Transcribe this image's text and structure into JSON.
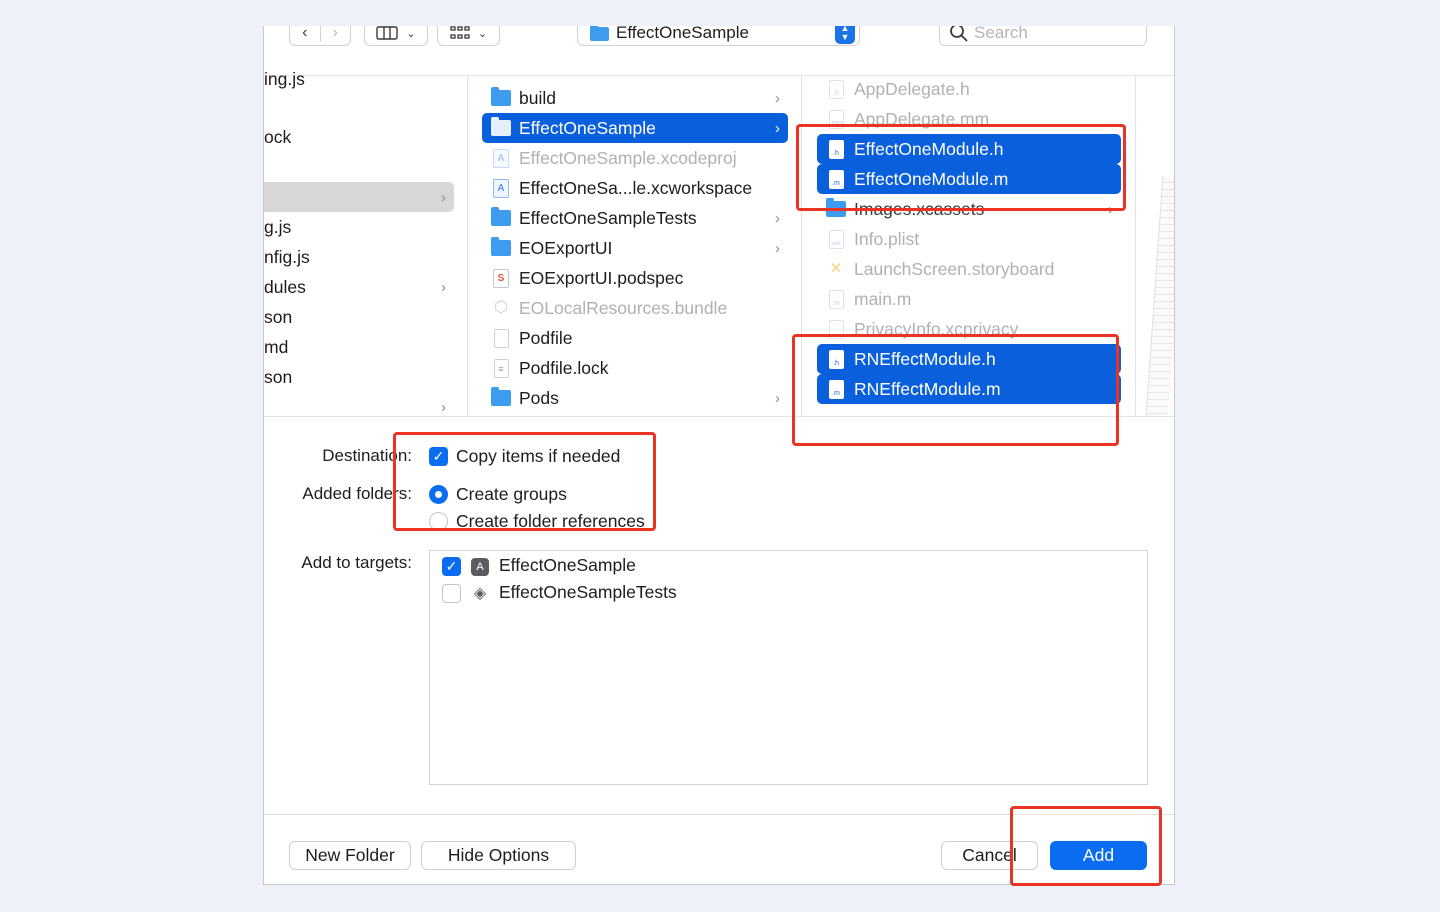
{
  "toolbar": {
    "back": "‹",
    "forward": "›",
    "path_title": "EffectOneSample",
    "search_placeholder": "Search"
  },
  "left_column": [
    {
      "label": "ing.js"
    },
    {
      "label": "ock"
    },
    {
      "label": "",
      "selected": true,
      "arrow": true
    },
    {
      "label": "g.js"
    },
    {
      "label": "nfig.js"
    },
    {
      "label": "dules",
      "arrow": true
    },
    {
      "label": "son"
    },
    {
      "label": "md"
    },
    {
      "label": "son"
    },
    {
      "label": "",
      "arrow": true
    }
  ],
  "middle_column": [
    {
      "label": "build",
      "icon": "folder-icon",
      "arrow": true
    },
    {
      "label": "EffectOneSample",
      "icon": "folder-icon",
      "arrow": true,
      "selected": true
    },
    {
      "label": "EffectOneSample.xcodeproj",
      "icon": "xcodeproj-icon",
      "faded": true
    },
    {
      "label": "EffectOneSa...le.xcworkspace",
      "icon": "xcworkspace-icon"
    },
    {
      "label": "EffectOneSampleTests",
      "icon": "folder-icon",
      "arrow": true
    },
    {
      "label": "EOExportUI",
      "icon": "folder-icon",
      "arrow": true
    },
    {
      "label": "EOExportUI.podspec",
      "icon": "swift-file-icon"
    },
    {
      "label": "EOLocalResources.bundle",
      "icon": "bundle-icon",
      "faded": true
    },
    {
      "label": "Podfile",
      "icon": "file-icon"
    },
    {
      "label": "Podfile.lock",
      "icon": "text-file-icon"
    },
    {
      "label": "Pods",
      "icon": "folder-icon",
      "arrow": true
    }
  ],
  "right_column": [
    {
      "label": "AppDelegate.h",
      "ext": ".h",
      "faded": true
    },
    {
      "label": "AppDelegate.mm",
      "ext": ".mm",
      "faded": true
    },
    {
      "label": "EffectOneModule.h",
      "ext": ".h",
      "selected": true
    },
    {
      "label": "EffectOneModule.m",
      "ext": ".m",
      "selected": true
    },
    {
      "label": "Images.xcassets",
      "icon": "folder-icon",
      "faded": true,
      "arrow": true
    },
    {
      "label": "Info.plist",
      "ext": "plist",
      "faded": true
    },
    {
      "label": "LaunchScreen.storyboard",
      "icon": "storyboard-icon",
      "faded": true
    },
    {
      "label": "main.m",
      "ext": ".m",
      "faded": true
    },
    {
      "label": "PrivacyInfo.xcprivacy",
      "ext": "",
      "faded": true
    },
    {
      "label": "RNEffectModule.h",
      "ext": ".h",
      "selected": true
    },
    {
      "label": "RNEffectModule.m",
      "ext": ".m",
      "selected": true
    }
  ],
  "options": {
    "destination_label": "Destination:",
    "copy_items_label": "Copy items if needed",
    "copy_items_checked": true,
    "added_folders_label": "Added folders:",
    "create_groups_label": "Create groups",
    "create_folder_refs_label": "Create folder references",
    "selected_folder_option": "Create groups",
    "add_to_targets_label": "Add to targets:",
    "targets": [
      {
        "label": "EffectOneSample",
        "checked": true
      },
      {
        "label": "EffectOneSampleTests",
        "checked": false
      }
    ]
  },
  "footer": {
    "new_folder": "New Folder",
    "hide_options": "Hide Options",
    "cancel": "Cancel",
    "add": "Add"
  },
  "colors": {
    "accent": "#0a6cf0",
    "selection": "#0a5fdc",
    "annotation": "#ea3323",
    "background": "#eff1fa"
  }
}
